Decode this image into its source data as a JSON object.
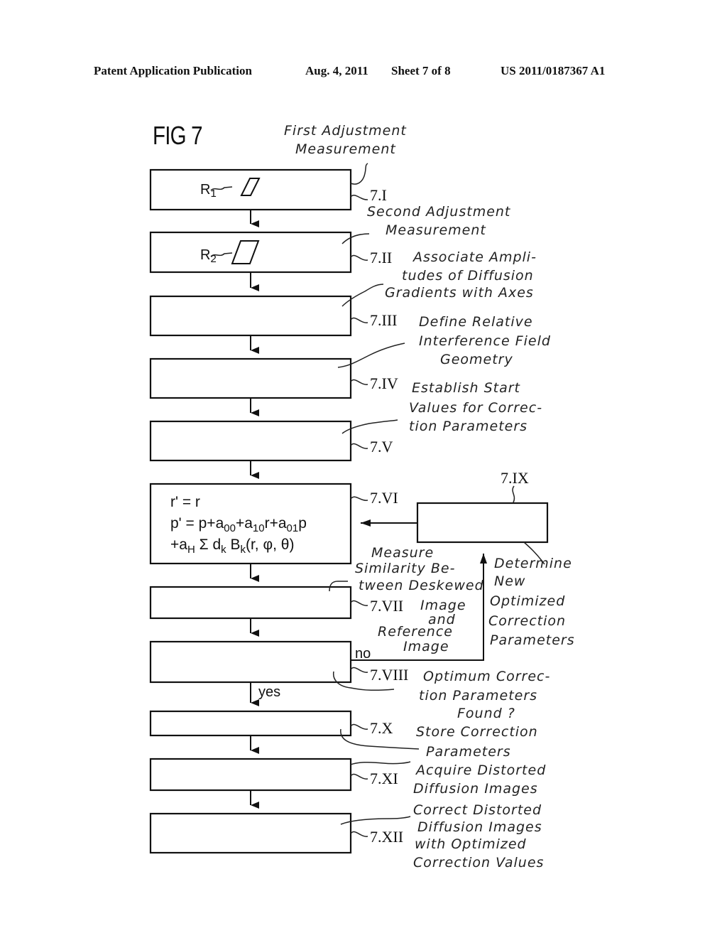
{
  "header": {
    "publication": "Patent Application Publication",
    "date": "Aug. 4, 2011",
    "sheet": "Sheet 7 of 8",
    "number": "US 2011/0187367 A1"
  },
  "figure": {
    "title": "FIG 7"
  },
  "steps": [
    {
      "ref": "7.I",
      "marker": "R",
      "marker_sub": "1",
      "caption": [
        "First Adjustment",
        "Measurement"
      ]
    },
    {
      "ref": "7.II",
      "marker": "R",
      "marker_sub": "2",
      "caption": [
        "Second Adjustment",
        "Measurement"
      ]
    },
    {
      "ref": "7.III",
      "caption": [
        "Associate Ampli-",
        "tudes of Diffusion",
        "Gradients with Axes"
      ]
    },
    {
      "ref": "7.IV",
      "caption": [
        "Define Relative",
        "Interference Field",
        "Geometry"
      ]
    },
    {
      "ref": "7.V",
      "caption": [
        "Establish Start",
        "Values for Correc-",
        "tion Parameters"
      ]
    },
    {
      "ref": "7.VI",
      "equation": {
        "line1": "r' = r",
        "line2_parts": [
          "p' = p+a",
          "00",
          "+a",
          "10",
          "r+a",
          "01",
          "p"
        ],
        "line3_parts": [
          "+a",
          "H",
          " Σ d",
          "k",
          " B",
          "k",
          "(r, φ, θ)"
        ]
      }
    },
    {
      "ref": "7.VII",
      "caption": [
        "Measure",
        "Similarity Be-",
        "tween Deskewed",
        "Image",
        "and",
        "Reference",
        "Image"
      ]
    },
    {
      "ref": "7.VIII",
      "caption": [
        "Optimum Correc-",
        "tion Parameters",
        "Found ?"
      ],
      "branch_no": "no",
      "branch_yes": "yes"
    },
    {
      "ref": "7.IX",
      "caption": [
        "Determine",
        "New",
        "Optimized",
        "Correction",
        "Parameters"
      ]
    },
    {
      "ref": "7.X",
      "caption": [
        "Store Correction",
        "Parameters"
      ]
    },
    {
      "ref": "7.XI",
      "caption": [
        "Acquire Distorted",
        "Diffusion Images"
      ]
    },
    {
      "ref": "7.XII",
      "caption": [
        "Correct Distorted",
        "Diffusion Images",
        "with Optimized",
        "Correction Values"
      ]
    }
  ]
}
